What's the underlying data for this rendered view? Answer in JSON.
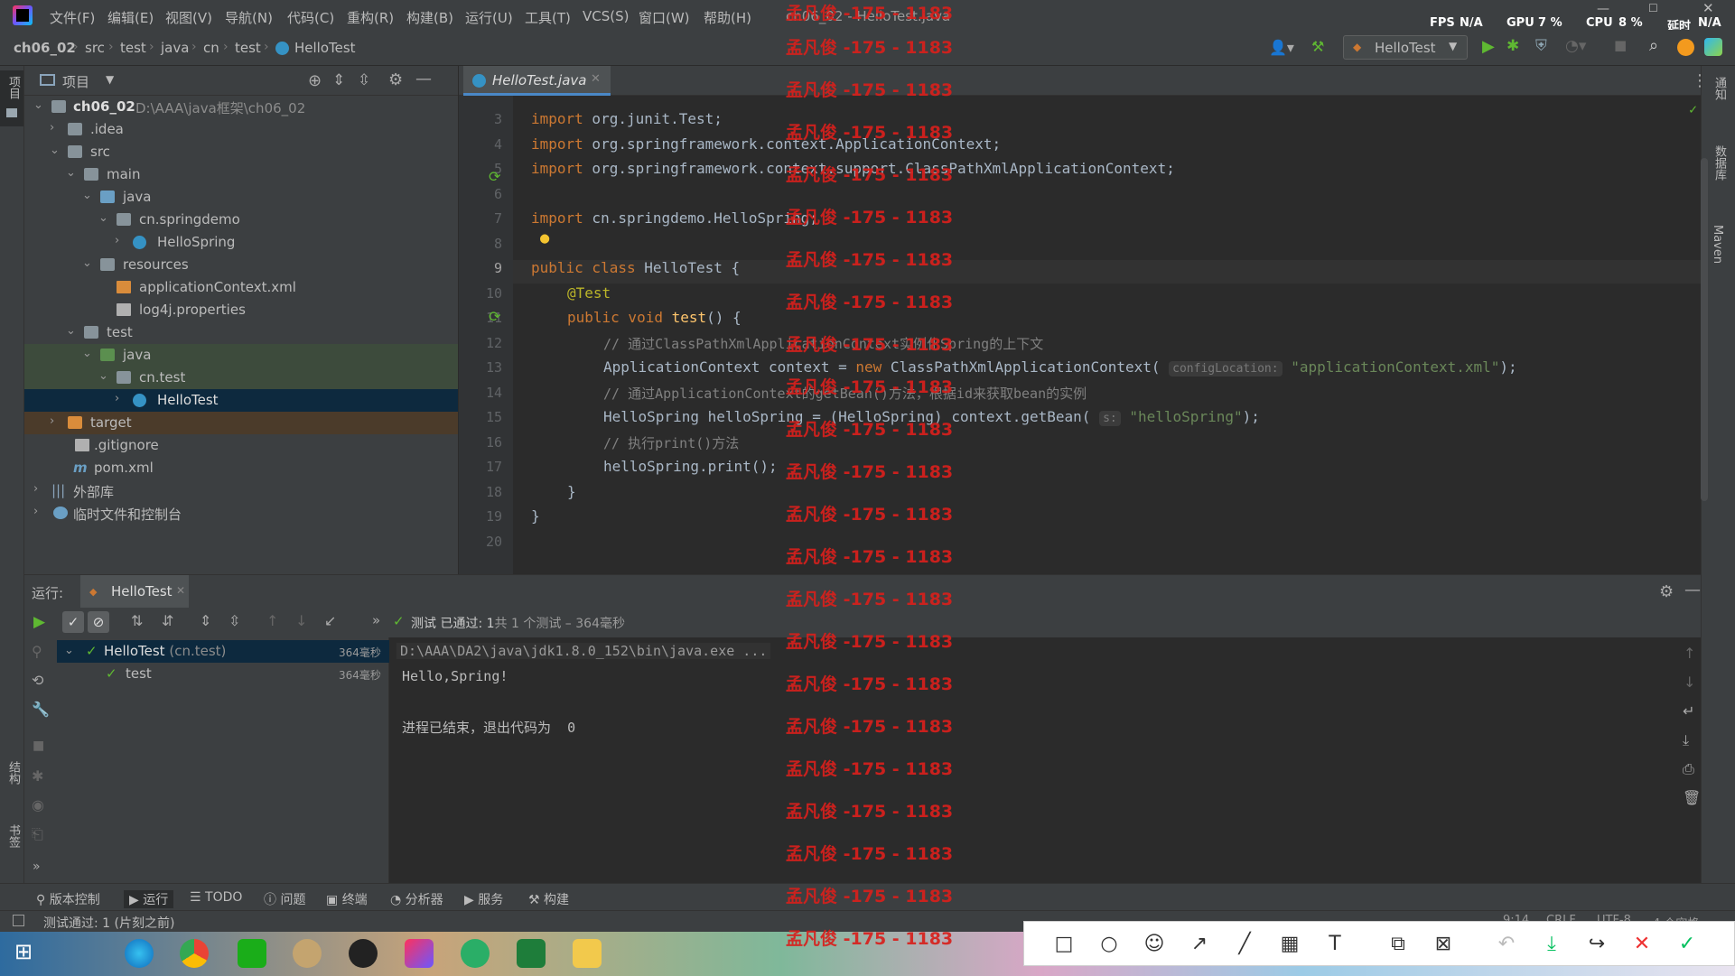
{
  "window": {
    "title": "ch06_02 - HelloTest.java",
    "menu": [
      "文件(F)",
      "编辑(E)",
      "视图(V)",
      "导航(N)",
      "代码(C)",
      "重构(R)",
      "构建(B)",
      "运行(U)",
      "工具(T)",
      "VCS(S)",
      "窗口(W)",
      "帮助(H)"
    ],
    "stats": {
      "fps_label": "FPS",
      "fps": "N/A",
      "gpu_label": "GPU",
      "gpu": "7 %",
      "cpu_label": "CPU",
      "cpu": "8 %",
      "latency_label": "延时",
      "latency": "N/A"
    }
  },
  "breadcrumb": [
    "ch06_02",
    "src",
    "test",
    "java",
    "cn",
    "test",
    "HelloTest"
  ],
  "run_config": "HelloTest",
  "project": {
    "header": "项目",
    "stripe_label": "项目",
    "tree": [
      {
        "label": "ch06_02",
        "path": "D:\\AAA\\java框架\\ch06_02"
      },
      {
        "label": ".idea"
      },
      {
        "label": "src"
      },
      {
        "label": "main"
      },
      {
        "label": "java"
      },
      {
        "label": "cn.springdemo"
      },
      {
        "label": "HelloSpring"
      },
      {
        "label": "resources"
      },
      {
        "label": "applicationContext.xml"
      },
      {
        "label": "log4j.properties"
      },
      {
        "label": "test"
      },
      {
        "label": "java"
      },
      {
        "label": "cn.test"
      },
      {
        "label": "HelloTest"
      },
      {
        "label": "target"
      },
      {
        "label": ".gitignore"
      },
      {
        "label": "pom.xml"
      },
      {
        "label": "外部库"
      },
      {
        "label": "临时文件和控制台"
      }
    ]
  },
  "editor": {
    "tab": "HelloTest.java",
    "line_numbers": [
      "3",
      "4",
      "5",
      "6",
      "7",
      "8",
      "9",
      "10",
      "11",
      "12",
      "13",
      "14",
      "15",
      "16",
      "17",
      "18",
      "19",
      "20"
    ],
    "code": {
      "l3_kw": "import",
      "l3": " org.junit.Test;",
      "l4_kw": "import",
      "l4": " org.springframework.context.ApplicationContext;",
      "l5_kw": "import",
      "l5": " org.springframework.context.support.ClassPathXmlApplicationContext;",
      "l7_kw": "import",
      "l7": " cn.springdemo.HelloSpring;",
      "l9_kw": "public class",
      "l9": " HelloTest {",
      "l10": "@Test",
      "l11_kw": "public void",
      "l11_fn": " test",
      "l11": "() {",
      "l12": "// 通过ClassPathXmlApplicationContext实例化Spring的上下文",
      "l13_a": "ApplicationContext context = ",
      "l13_kw": "new",
      "l13_b": " ClassPathXmlApplicationContext(",
      "l13_hint": "configLocation:",
      "l13_str": "\"applicationContext.xml\"",
      "l13_c": ");",
      "l14": "// 通过ApplicationContext的getBean()方法，根据id来获取bean的实例",
      "l15_a": "HelloSpring helloSpring = (HelloSpring) context.getBean(",
      "l15_hint": "s:",
      "l15_str": "\"helloSpring\"",
      "l15_c": ");",
      "l16": "// 执行print()方法",
      "l17": "helloSpring.print();",
      "l18": "}",
      "l19": "}"
    }
  },
  "run": {
    "label": "运行:",
    "tab": "HelloTest",
    "status": "测试 已通过:",
    "status_count": "1",
    "status_detail": "共 1 个测试 – 364毫秒",
    "tree": [
      {
        "label": "HelloTest",
        "pkg": "(cn.test)",
        "time": "364毫秒"
      },
      {
        "label": "test",
        "time": "364毫秒"
      }
    ],
    "console": {
      "cmd": "D:\\AAA\\DA2\\java\\jdk1.8.0_152\\bin\\java.exe ...",
      "out": "Hello,Spring!",
      "exit": "进程已结束，退出代码为  0"
    }
  },
  "toolwindows": [
    "版本控制",
    "运行",
    "TODO",
    "问题",
    "终端",
    "分析器",
    "服务",
    "构建"
  ],
  "statusbar": {
    "message": "测试通过: 1 (片刻之前)",
    "pos": "9:14",
    "eol": "CRLF",
    "enc": "UTF-8",
    "indent": "4 个空格"
  },
  "right_stripe": [
    "通知",
    "数据库",
    "Maven"
  ],
  "left_stripe_bottom": [
    "结构",
    "书签"
  ],
  "watermark": "孟凡俊 -175 - 1183",
  "colors": {
    "keyword": "#cc7832",
    "string": "#6a8759",
    "comment": "#808080",
    "function": "#ffc66d",
    "annotation": "#bbb529",
    "watermark": "#d8201c",
    "accent": "#4a88c7"
  }
}
